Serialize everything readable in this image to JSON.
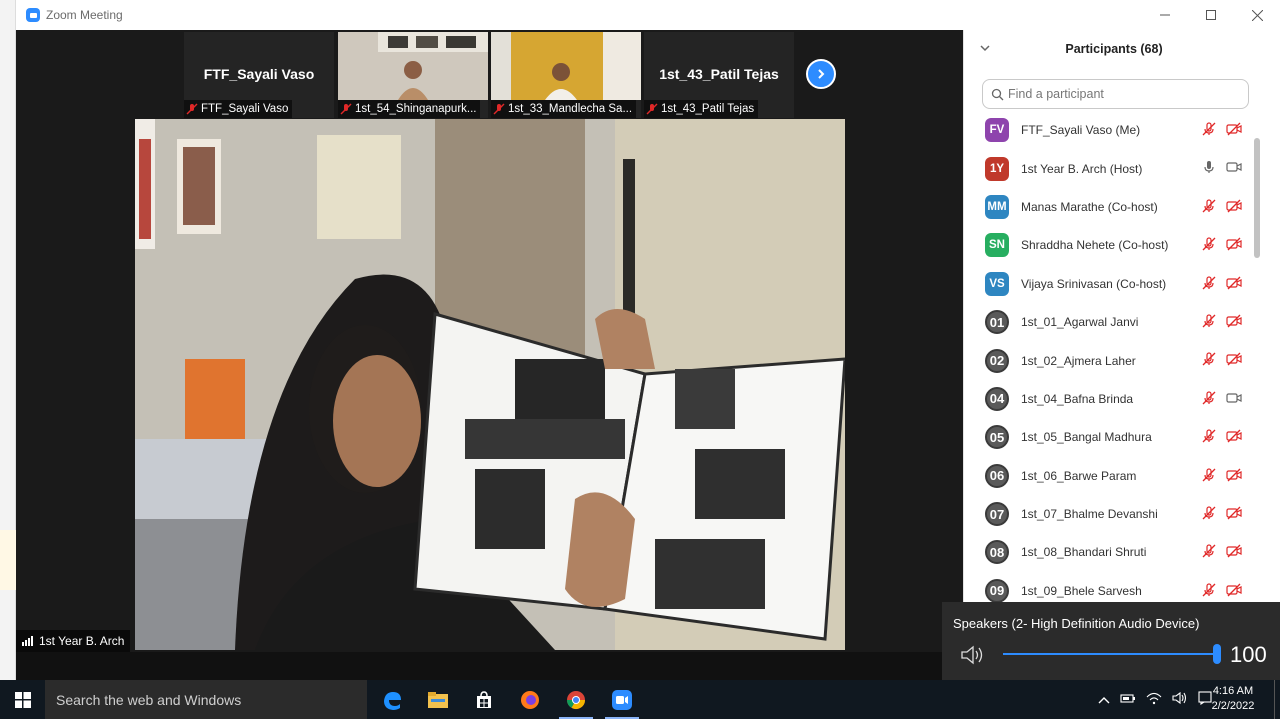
{
  "window": {
    "title": "Zoom Meeting",
    "controls": [
      "minimize-icon",
      "maximize-icon",
      "close-icon"
    ]
  },
  "thumbnails": [
    {
      "display_name": "FTF_Sayali Vaso",
      "label": "FTF_Sayali Vaso",
      "video": false,
      "muted": true
    },
    {
      "display_name": "",
      "label": "1st_54_Shinganapurk...",
      "video": true,
      "muted": true
    },
    {
      "display_name": "",
      "label": "1st_33_Mandlecha Sa...",
      "video": true,
      "muted": true
    },
    {
      "display_name": "1st_43_Patil Tejas",
      "label": "1st_43_Patil Tejas",
      "video": false,
      "muted": true
    }
  ],
  "active_speaker": {
    "label": "1st Year B. Arch"
  },
  "participants_panel": {
    "title": "Participants (68)",
    "search_placeholder": "Find a participant",
    "items": [
      {
        "initials": "FV",
        "color": "#8e44ad",
        "name": "FTF_Sayali Vaso (Me)",
        "mic": "muted",
        "video": "off",
        "style": "initials"
      },
      {
        "initials": "1Y",
        "color": "#c0392b",
        "name": "1st Year B. Arch (Host)",
        "mic": "on",
        "video": "on",
        "style": "initials"
      },
      {
        "initials": "MM",
        "color": "#2e86c1",
        "name": "Manas Marathe (Co-host)",
        "mic": "muted",
        "video": "off",
        "style": "initials"
      },
      {
        "initials": "SN",
        "color": "#27ae60",
        "name": "Shraddha Nehete (Co-host)",
        "mic": "muted",
        "video": "off",
        "style": "initials"
      },
      {
        "initials": "VS",
        "color": "#2e86c1",
        "name": "Vijaya Srinivasan (Co-host)",
        "mic": "muted",
        "video": "off",
        "style": "initials"
      },
      {
        "initials": "01",
        "color": "#5a5a5a",
        "name": "1st_01_Agarwal Janvi",
        "mic": "muted",
        "video": "off",
        "style": "number"
      },
      {
        "initials": "02",
        "color": "#5a5a5a",
        "name": "1st_02_Ajmera Laher",
        "mic": "muted",
        "video": "off",
        "style": "number"
      },
      {
        "initials": "04",
        "color": "#5a5a5a",
        "name": "1st_04_Bafna Brinda",
        "mic": "muted",
        "video": "on",
        "style": "number"
      },
      {
        "initials": "05",
        "color": "#5a5a5a",
        "name": "1st_05_Bangal Madhura",
        "mic": "muted",
        "video": "off",
        "style": "number"
      },
      {
        "initials": "06",
        "color": "#5a5a5a",
        "name": "1st_06_Barwe Param",
        "mic": "muted",
        "video": "off",
        "style": "number"
      },
      {
        "initials": "07",
        "color": "#5a5a5a",
        "name": "1st_07_Bhalme Devanshi",
        "mic": "muted",
        "video": "off",
        "style": "number"
      },
      {
        "initials": "08",
        "color": "#5a5a5a",
        "name": "1st_08_Bhandari Shruti",
        "mic": "muted",
        "video": "off",
        "style": "number"
      },
      {
        "initials": "09",
        "color": "#5a5a5a",
        "name": "1st_09_Bhele Sarvesh",
        "mic": "muted",
        "video": "off",
        "style": "number"
      }
    ]
  },
  "volume_popup": {
    "device": "Speakers (2- High Definition Audio Device)",
    "level": 100
  },
  "taskbar": {
    "search_placeholder": "Search the web and Windows",
    "apps": [
      "edge-icon",
      "file-explorer-icon",
      "store-icon",
      "firefox-icon",
      "chrome-icon",
      "zoom-icon"
    ],
    "time": "4:16 AM",
    "date": "2/2/2022"
  },
  "colors": {
    "accent": "#2d8cff",
    "muted_red": "#e02828",
    "panel_bg": "#ffffff",
    "meeting_bg": "#1a1a1a"
  }
}
